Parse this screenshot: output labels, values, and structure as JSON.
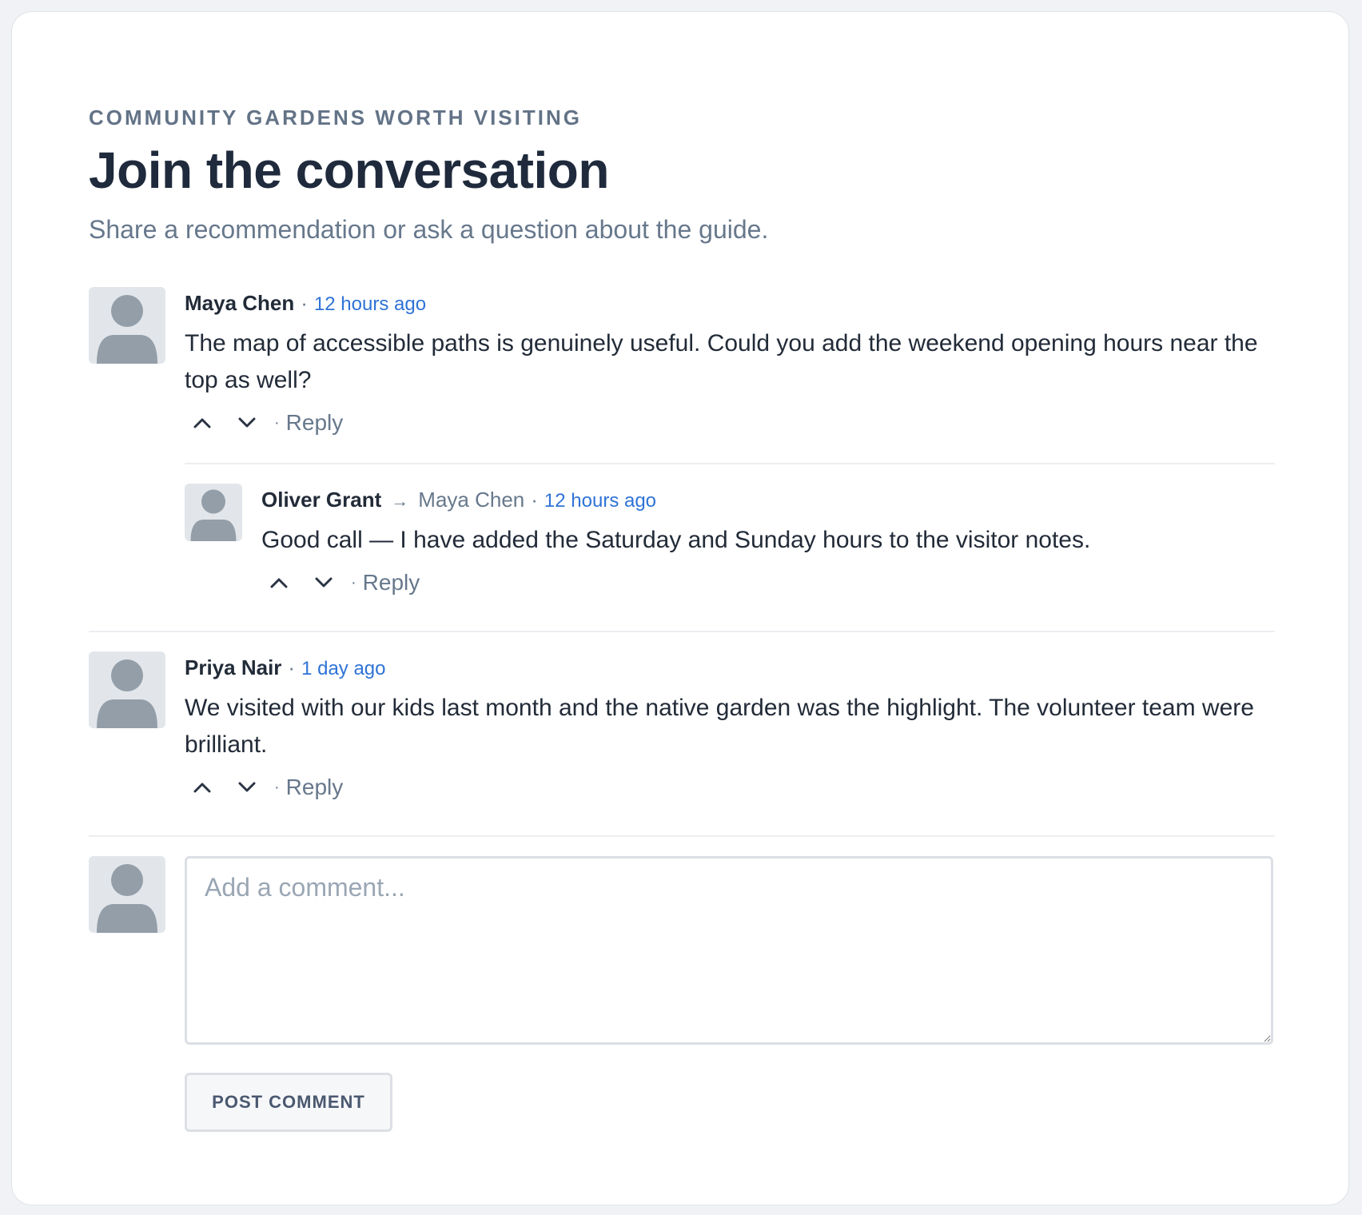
{
  "header": {
    "eyebrow": "COMMUNITY GARDENS WORTH VISITING",
    "title": "Join the conversation",
    "subtitle": "Share a recommendation or ask a question about the guide."
  },
  "separator": "·",
  "reply_label": "Reply",
  "comments": [
    {
      "author": "Maya Chen",
      "time": "12 hours ago",
      "text": "The map of accessible paths is genuinely useful. Could you add the weekend opening hours near the top as well?",
      "replies": [
        {
          "author": "Oliver Grant",
          "reply_arrow": "→",
          "reply_to": "Maya Chen",
          "time": "12 hours ago",
          "text": "Good call — I have added the Saturday and Sunday hours to the visitor notes."
        }
      ]
    },
    {
      "author": "Priya Nair",
      "time": "1 day ago",
      "text": "We visited with our kids last month and the native garden was the highlight. The volunteer team were brilliant."
    }
  ],
  "composer": {
    "placeholder": "Add a comment...",
    "value": "",
    "post_label": "POST COMMENT"
  },
  "icons": {
    "avatar": "user-avatar-icon",
    "upvote": "chevron-up-icon",
    "downvote": "chevron-down-icon"
  },
  "colors": {
    "background": "#f0f2f5",
    "card": "#ffffff",
    "title": "#1f2a3c",
    "muted": "#67788c",
    "link": "#2f73d6",
    "avatar_bg": "#e2e6ea",
    "avatar_fg": "#939ea9"
  }
}
